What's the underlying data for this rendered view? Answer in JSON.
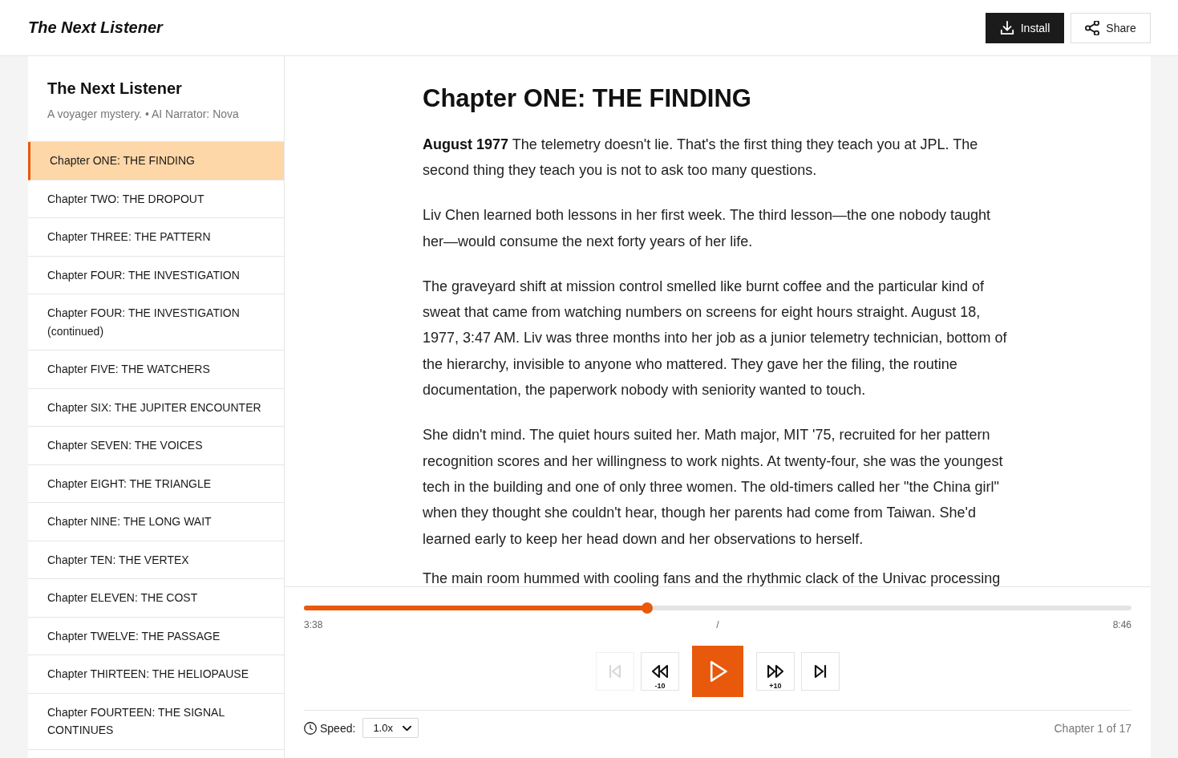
{
  "header": {
    "title": "The Next Listener",
    "buttons": [
      {
        "kind": "install",
        "label": "Install"
      },
      {
        "kind": "share",
        "label": "Share"
      }
    ]
  },
  "book": {
    "title": "The Next Listener",
    "subtitle": "A voyager mystery. • AI Narrator: Nova"
  },
  "chapters": [
    {
      "label": "Chapter ONE: THE FINDING",
      "selected": true
    },
    {
      "label": "Chapter TWO: THE DROPOUT",
      "selected": false
    },
    {
      "label": "Chapter THREE: THE PATTERN",
      "selected": false
    },
    {
      "label": "Chapter FOUR: THE INVESTIGATION",
      "selected": false
    },
    {
      "label": "Chapter FOUR: THE INVESTIGATION (continued)",
      "selected": false
    },
    {
      "label": "Chapter FIVE: THE WATCHERS",
      "selected": false
    },
    {
      "label": "Chapter SIX: THE JUPITER ENCOUNTER",
      "selected": false
    },
    {
      "label": "Chapter SEVEN: THE VOICES",
      "selected": false
    },
    {
      "label": "Chapter EIGHT: THE TRIANGLE",
      "selected": false
    },
    {
      "label": "Chapter NINE: THE LONG WAIT",
      "selected": false
    },
    {
      "label": "Chapter TEN: THE VERTEX",
      "selected": false
    },
    {
      "label": "Chapter ELEVEN: THE COST",
      "selected": false
    },
    {
      "label": "Chapter TWELVE: THE PASSAGE",
      "selected": false
    },
    {
      "label": "Chapter THIRTEEN: THE HELIOPAUSE",
      "selected": false
    },
    {
      "label": "Chapter FOURTEEN: THE SIGNAL CONTINUES",
      "selected": false
    }
  ],
  "chapter": {
    "heading": "Chapter ONE: THE FINDING",
    "paragraphs": [
      "**August 1977** The telemetry doesn't lie. That's the first thing they teach you at JPL. The second thing they teach you is not to ask too many questions.",
      "Liv Chen learned both lessons in her first week. The third lesson—the one nobody taught her—would consume the next forty years of her life.",
      "The graveyard shift at mission control smelled like burnt coffee and the particular kind of sweat that came from watching numbers on screens for eight hours straight. August 18, 1977, 3:47 AM. Liv was three months into her job as a junior telemetry technician, bottom of the hierarchy, invisible to anyone who mattered. They gave her the filing, the routine documentation, the paperwork nobody with seniority wanted to touch.",
      "She didn't mind. The quiet hours suited her. Math major, MIT '75, recruited for her pattern recognition scores and her willingness to work nights. At twenty-four, she was the youngest tech in the building and one of only three women. The old-timers called her \"the China girl\" when they thought she couldn't hear, though her parents had come from Taiwan. She'd learned early to keep her head down and her observations to herself.",
      "The main room hummed with cooling fans and the rhythmic clack of the Univac processing"
    ]
  },
  "player": {
    "progress": {
      "level": 0.415
    },
    "elapsed": "3:38",
    "separator": "/",
    "duration": "8:46",
    "controls": [
      {
        "kind": "previous",
        "disabled": true
      },
      {
        "kind": "rewind",
        "label": "-10",
        "disabled": false
      },
      {
        "kind": "play",
        "disabled": false
      },
      {
        "kind": "forward",
        "label": "+10",
        "disabled": false
      },
      {
        "kind": "next",
        "disabled": false
      }
    ],
    "speed": {
      "label": "Speed:",
      "value": "1.0x"
    },
    "position": "Chapter 1 of 17"
  }
}
